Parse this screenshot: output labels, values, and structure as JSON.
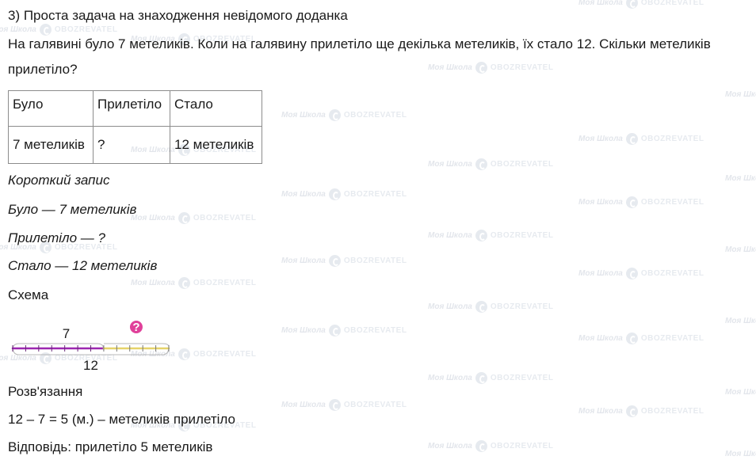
{
  "task_title": "3) Проста задача на знаходження невідомого доданка",
  "problem": {
    "line1": "На галявині було 7 метеликів. Коли на галявину прилетіло ще декілька метеликів, їх стало 12. Скільки метеликів",
    "line2": "прилетіло?"
  },
  "table": {
    "headers": [
      "Було",
      "Прилетіло",
      "Стало"
    ],
    "values": [
      "7 метеликів",
      "?",
      "12 метеликів"
    ]
  },
  "short_record": {
    "heading": "Короткий запис",
    "items": [
      "Було — 7 метеликів",
      "Прилетіло — ?",
      "Стало — 12 метеликів"
    ]
  },
  "scheme": {
    "heading": "Схема",
    "known_part_value": 7,
    "total_value": 12,
    "known_label": "7",
    "unknown_label": "?",
    "total_label": "12",
    "known_color": "#9c27b0",
    "unknown_color": "#e6d36a",
    "question_badge_color": "#e0409a"
  },
  "solution": {
    "heading": "Розв'язання",
    "expression": "12 – 7 = 5 (м.) – метеликів прилетіло"
  },
  "answer": "Відповідь: прилетіло 5 метеликів",
  "watermark": {
    "brand_a": "Моя Школа",
    "brand_b": "OBOZREVATEL"
  }
}
